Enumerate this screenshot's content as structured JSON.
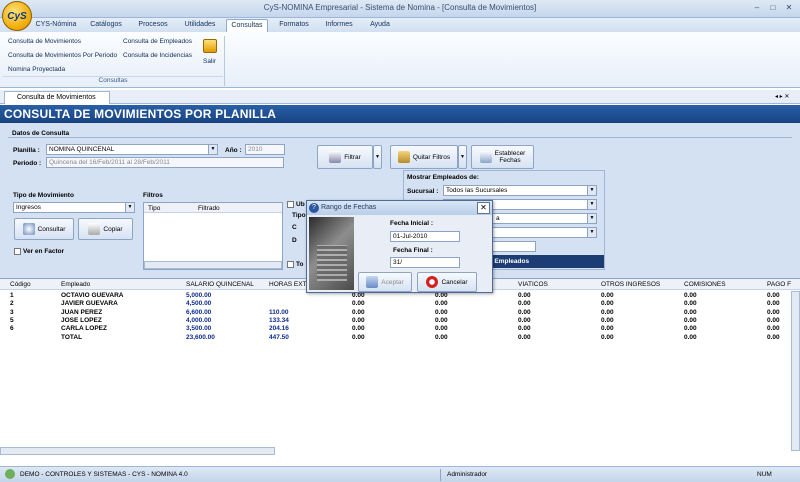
{
  "window": {
    "title": "CyS-NOMINA Empresarial - Sistema de Nomina - [Consulta de Movimientos]"
  },
  "icons": {
    "logo": "cys-logo",
    "salir": "key-icon",
    "filtrar": "filter-icon",
    "quitar": "remove-filter-icon",
    "fechas": "calendar-icon",
    "consultar": "search-icon",
    "copiar": "copy-icon",
    "aceptar": "arrow-down-icon",
    "cancelar": "cancel-icon",
    "dialog": "question-icon"
  },
  "menu": [
    "CYS-Nómina",
    "Catálogos",
    "Procesos",
    "Utilidades",
    "Consultas",
    "Formatos",
    "Informes",
    "Ayuda"
  ],
  "ribbon": {
    "col1": [
      "Consulta de Movimientos",
      "Consulta de Movimientos Por Periodo",
      "Nomina Proyectada"
    ],
    "col2": [
      "Consulta de Empleados",
      "Consulta de Incidencias"
    ],
    "salir": "Salir",
    "group": "Consultas"
  },
  "doc_tab": "Consulta de Movimientos",
  "heading": "CONSULTA DE MOVIMIENTOS POR PLANILLA",
  "form": {
    "datos_label": "Datos de Consulta",
    "planilla_label": "Planilla :",
    "planilla_value": "NOMINA QUINCENAL",
    "anio_label": "Año :",
    "anio_value": "2010",
    "periodo_label": "Periodo :",
    "periodo_value": "Quincena del 16/Feb/2011 al 28/Feb/2011",
    "filtrar": "Filtrar",
    "quitar": "Quitar Filtros",
    "establecer": "Establecer",
    "fechas": "Fechas",
    "tipo_label": "Tipo de Movimiento",
    "tipo_value": "Ingresos",
    "consultar": "Consultar",
    "copiar": "Copiar",
    "ver_factor": "Ver en Factor",
    "filtros_label": "Filtros",
    "filtros_cols": [
      "Tipo",
      "Filtrado"
    ],
    "opt_u": "Ub",
    "opt_tip": "Tipo",
    "opt_c": "C",
    "opt_d": "D",
    "opt_to": "To",
    "mostrar_label": "Mostrar Empleados de:",
    "sucursal_label": "Sucursal :",
    "sucursal_value": "Todos las Sucursales",
    "todos_empleados": "os Empleados",
    "extra_value": "a"
  },
  "dialog": {
    "title": "Rango de Fechas",
    "fi_label": "Fecha Inicial :",
    "fi_value": "01-Jul-2010",
    "ff_label": "Fecha Final :",
    "ff_value": "31/",
    "aceptar": "Aceptar",
    "cancelar": "Cancelar"
  },
  "grid": {
    "headers": [
      "Código",
      "Empleado",
      "SALARIO QUINCENAL",
      "HORAS EXT",
      "VIATICOS",
      "OTROS INGRESOS",
      "COMISIONES",
      "PAGO F"
    ],
    "rows": [
      {
        "codigo": "1",
        "empleado": "OCTAVIO GUEVARA",
        "salario": "5,000.00",
        "horas": "",
        "c4": "0.00",
        "c5": "0.00",
        "c6": "0.00",
        "viat": "0.00",
        "otros": "0.00",
        "com": "0.00",
        "pago": "0.00"
      },
      {
        "codigo": "2",
        "empleado": "JAVIER GUEVARA",
        "salario": "4,500.00",
        "horas": "",
        "c4": "0.00",
        "c5": "0.00",
        "c6": "0.00",
        "viat": "0.00",
        "otros": "0.00",
        "com": "0.00",
        "pago": "0.00"
      },
      {
        "codigo": "3",
        "empleado": "JUAN PEREZ",
        "salario": "6,600.00",
        "horas": "110.00",
        "c4": "0.00",
        "c5": "0.00",
        "c6": "0.00",
        "viat": "0.00",
        "otros": "0.00",
        "com": "0.00",
        "pago": "0.00"
      },
      {
        "codigo": "5",
        "empleado": "JOSE LOPEZ",
        "salario": "4,000.00",
        "horas": "133.34",
        "c4": "0.00",
        "c5": "0.00",
        "c6": "0.00",
        "viat": "0.00",
        "otros": "0.00",
        "com": "0.00",
        "pago": "0.00"
      },
      {
        "codigo": "6",
        "empleado": "CARLA LOPEZ",
        "salario": "3,500.00",
        "horas": "204.16",
        "c4": "0.00",
        "c5": "0.00",
        "c6": "0.00",
        "viat": "0.00",
        "otros": "0.00",
        "com": "0.00",
        "pago": "0.00"
      },
      {
        "codigo": "",
        "empleado": "TOTAL",
        "salario": "23,600.00",
        "horas": "447.50",
        "c4": "0.00",
        "c5": "0.00",
        "c6": "0.00",
        "viat": "0.00",
        "otros": "0.00",
        "com": "0.00",
        "pago": "0.00"
      }
    ]
  },
  "status": {
    "left": "DEMO - CONTROLES Y SISTEMAS - CYS - NOMINA 4.0",
    "user": "Administrador",
    "num": "NUM"
  }
}
